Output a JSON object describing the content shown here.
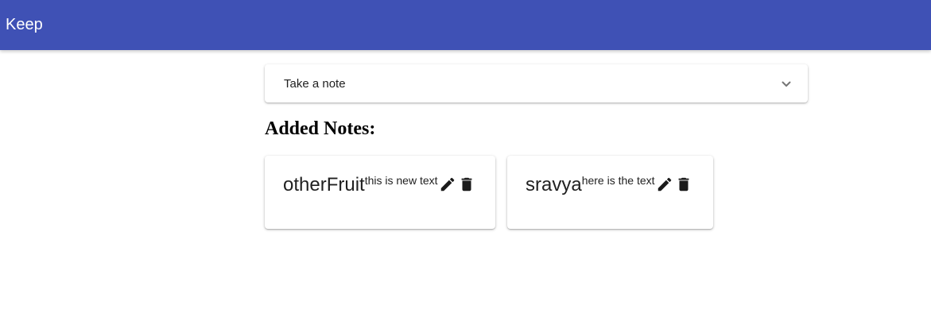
{
  "appbar": {
    "title": "Keep",
    "color": "#3f51b5"
  },
  "note_input": {
    "label": "Take a note",
    "expand_icon": "chevron-down-icon"
  },
  "notes_section": {
    "heading": "Added Notes:"
  },
  "notes": [
    {
      "title": "otherFruit",
      "text": "this is new text",
      "edit_icon": "pencil-icon",
      "delete_icon": "trash-icon"
    },
    {
      "title": "sravya",
      "text": "here is the text",
      "edit_icon": "pencil-icon",
      "delete_icon": "trash-icon"
    }
  ]
}
